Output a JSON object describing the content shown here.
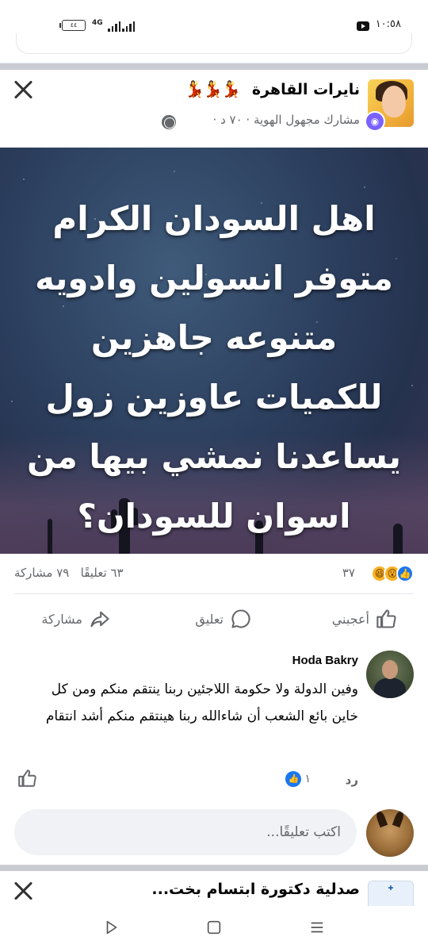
{
  "status_bar": {
    "time": "١٠:٥٨",
    "battery": "٤٤",
    "network": "4G"
  },
  "post": {
    "group_name": "نايرات القاهرة",
    "emoji_decor": "💃💃💃",
    "meta": "مشارك مجهول الهوية · ٧٠ د ·",
    "image_text_lines": [
      "اهل السودان الكرام",
      "متوفر انسولين وادويه",
      "متنوعه جاهزين",
      "للكميات عاوزين زول",
      "يساعدنا نمشي بيها من",
      "اسوان للسودان؟"
    ],
    "reaction_count": "٣٧",
    "comments_count": "٦٣ تعليقًا",
    "shares_count": "٧٩ مشاركة"
  },
  "actions": {
    "like_label": "أعجبني",
    "comment_label": "تعليق",
    "share_label": "مشاركة"
  },
  "comment": {
    "author": "Hoda Bakry",
    "text": "وفين الدولة ولا حكومة اللاجئين ربنا ينتقم منكم ومن كل خاين بائع الشعب أن شاءالله ربنا هينتقم منكم أشد انتقام",
    "reply_label": "رد",
    "like_count": "١"
  },
  "comment_input": {
    "placeholder": "اكتب تعليقًا..."
  },
  "next_post": {
    "title": "صدلية دكتورة ابتسام بخت..."
  },
  "colors": {
    "accent": "#1877f2",
    "secondary_text": "#65676b",
    "divider": "#e4e6eb"
  }
}
